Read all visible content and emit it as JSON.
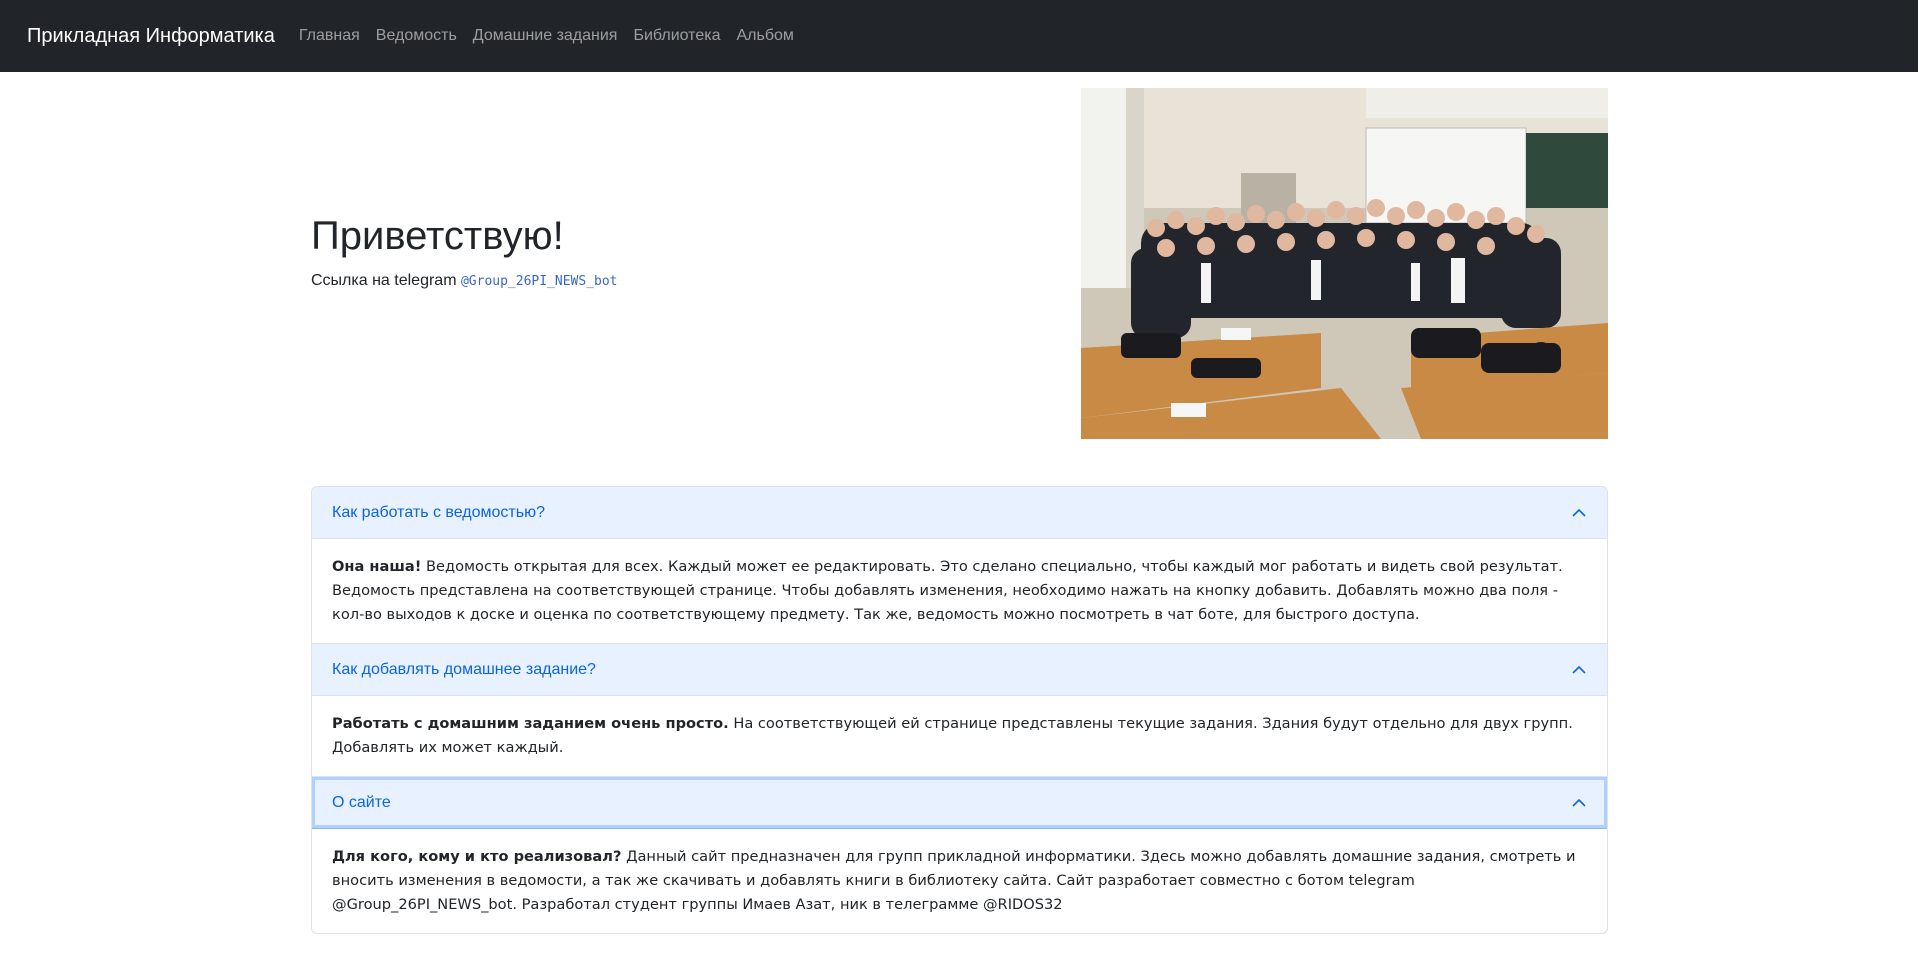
{
  "navbar": {
    "brand": "Прикладная Информатика",
    "links": [
      "Главная",
      "Ведомость",
      "Домашние задания",
      "Библиотека",
      "Альбом"
    ]
  },
  "hero": {
    "title": "Приветствую!",
    "subtitle_prefix": "Ссылка на telegram ",
    "telegram_handle": "@Group_26PI_NEWS_bot",
    "photo_icon": "group-photo"
  },
  "accordion": [
    {
      "title": "Как работать с ведомостью?",
      "body_strong": "Она наша!",
      "body_text": " Ведомость открытая для всех. Каждый может ее редактировать. Это сделано специально, чтобы каждый мог работать и видеть свой результат. Ведомость представлена на соответствующей странице. Чтобы добавлять изменения, необходимо нажать на кнопку добавить. Добавлять можно два поля - кол-во выходов к доске и оценка по соответствующему предмету. Так же, ведомость можно посмотреть в чат боте, для быстрого доступа."
    },
    {
      "title": "Как добавлять домашнее задание?",
      "body_strong": "Работать с домашним заданием очень просто.",
      "body_text": " На соответствующей ей странице представлены текущие задания. Здания будут отдельно для двух групп. Добавлять их может каждый."
    },
    {
      "title": "О сайте",
      "body_strong": "Для кого, кому и кто реализовал?",
      "body_text": " Данный сайт предназначен для групп прикладной информатики. Здесь можно добавлять домашние задания, смотреть и вносить изменения в ведомости, а так же скачивать и добавлять книги в библиотеку сайта. Сайт разработает совместно с ботом telegram @Group_26PI_NEWS_bot. Разработал студент группы Имаев Азат, ник в телеграмме @RIDOS32"
    }
  ],
  "colors": {
    "navbar_bg": "#212529",
    "accordion_header_bg": "#e7f1ff",
    "accordion_header_text": "#0c63e4",
    "link_blue": "#3a66c9"
  }
}
